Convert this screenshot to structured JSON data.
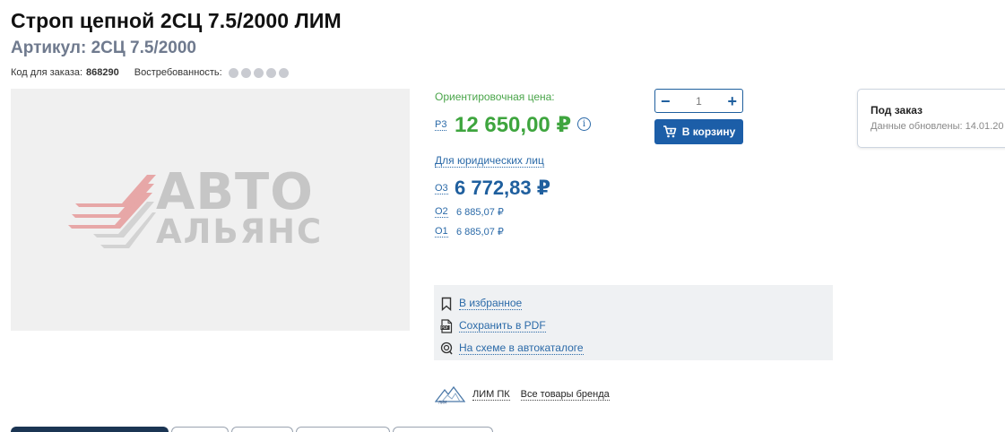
{
  "product": {
    "title": "Строп цепной 2СЦ 7.5/2000 ЛИМ",
    "article": "Артикул: 2СЦ 7.5/2000",
    "order_code_label": "Код для заказа:",
    "order_code": "868290",
    "demand_label": "Востребованность:",
    "demand_level": 0
  },
  "image": {
    "logo_line1": "АВТО",
    "logo_line2": "АЛЬЯНС"
  },
  "pricing": {
    "estimated_label": "Ориентировочная цена:",
    "p3_code": "Р3",
    "p3_price": "12 650,00 ₽",
    "legal_link": "Для юридических лиц",
    "o3_code": "О3",
    "o3_price": "6 772,83 ₽",
    "o2_code": "О2",
    "o2_price": "6 885,07 ₽",
    "o1_code": "О1",
    "o1_price": "6 885,07 ₽"
  },
  "cart": {
    "quantity": "1",
    "minus": "−",
    "plus": "+",
    "button_label": "В корзину"
  },
  "stock": {
    "title": "Под заказ",
    "updated": "Данные обновлены: 14.01.20"
  },
  "actions": [
    {
      "label": "В избранное",
      "icon": "bookmark-icon"
    },
    {
      "label": "Сохранить в PDF",
      "icon": "pdf-icon"
    },
    {
      "label": "На схеме в автокаталоге",
      "icon": "scheme-icon"
    }
  ],
  "brand": {
    "name": "ЛИМ ПК",
    "all_goods": "Все товары бренда"
  },
  "colors": {
    "price_green": "#3ea53e",
    "link_blue": "#2b6aa8",
    "button_blue": "#1c5ea8",
    "active_tab": "#1b3553"
  }
}
